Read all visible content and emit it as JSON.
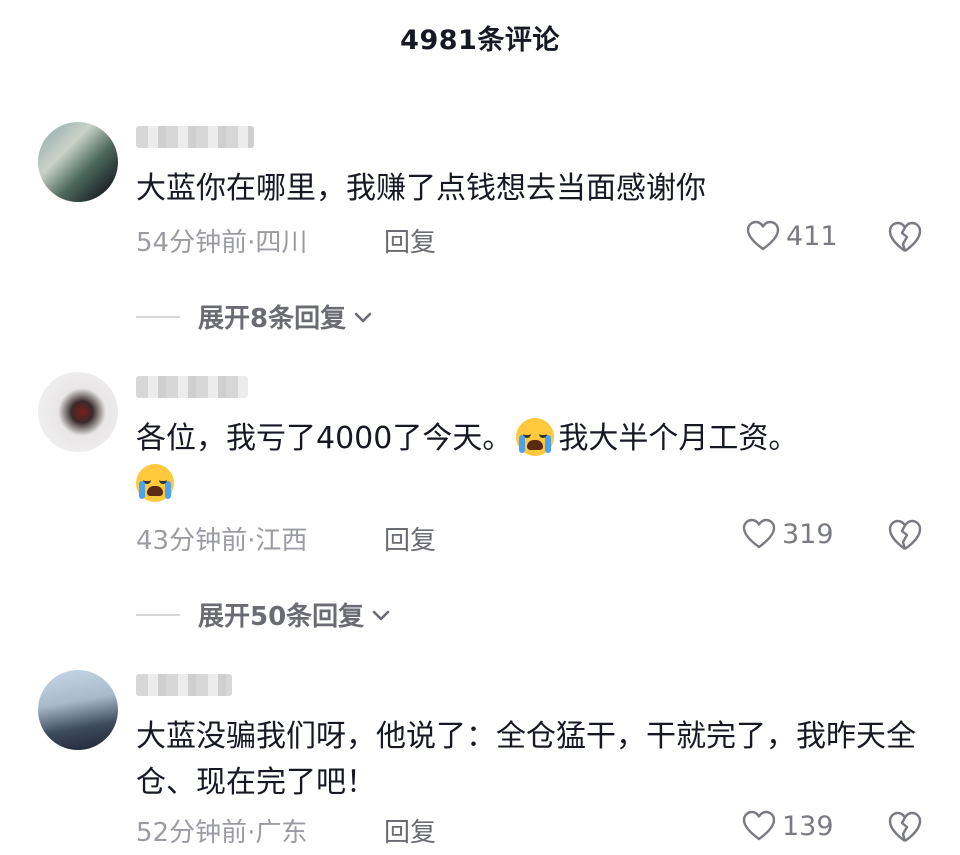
{
  "header": {
    "title": "4981条评论"
  },
  "comments": [
    {
      "text": "大蓝你在哪里，我赚了点钱想去当面感谢你",
      "time": "54分钟前",
      "location": "四川",
      "reply_label": "回复",
      "likes": "411",
      "expand_label": "展开8条回复"
    },
    {
      "text_a": "各位，我亏了4000了今天。",
      "text_b": "我大半个月工资。",
      "emoji": "loudly-crying-face",
      "time": "43分钟前",
      "location": "江西",
      "reply_label": "回复",
      "likes": "319",
      "expand_label": "展开50条回复"
    },
    {
      "text": "大蓝没骗我们呀，他说了：全仓猛干，干就完了，我昨天全仓、现在完了吧！",
      "time": "52分钟前",
      "location": "广东",
      "reply_label": "回复",
      "likes": "139"
    }
  ],
  "separator": "·"
}
